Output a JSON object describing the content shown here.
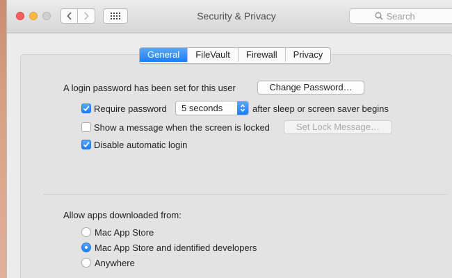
{
  "window": {
    "title": "Security & Privacy",
    "search_placeholder": "Search"
  },
  "tabs": [
    {
      "label": "General",
      "active": true
    },
    {
      "label": "FileVault",
      "active": false
    },
    {
      "label": "Firewall",
      "active": false
    },
    {
      "label": "Privacy",
      "active": false
    }
  ],
  "general": {
    "login_text": "A login password has been set for this user",
    "change_password_label": "Change Password…",
    "require_password": {
      "label": "Require password",
      "checked": true,
      "delay_value": "5 seconds",
      "suffix": "after sleep or screen saver begins"
    },
    "show_message": {
      "label": "Show a message when the screen is locked",
      "checked": false,
      "button_label": "Set Lock Message…"
    },
    "disable_autologin": {
      "label": "Disable automatic login",
      "checked": true
    }
  },
  "apps": {
    "heading": "Allow apps downloaded from:",
    "options": [
      {
        "label": "Mac App Store",
        "selected": false
      },
      {
        "label": "Mac App Store and identified developers",
        "selected": true
      },
      {
        "label": "Anywhere",
        "selected": false
      }
    ]
  },
  "colors": {
    "accent": "#1b7ff4",
    "close": "#fc605c",
    "minimize": "#fdbc40"
  }
}
